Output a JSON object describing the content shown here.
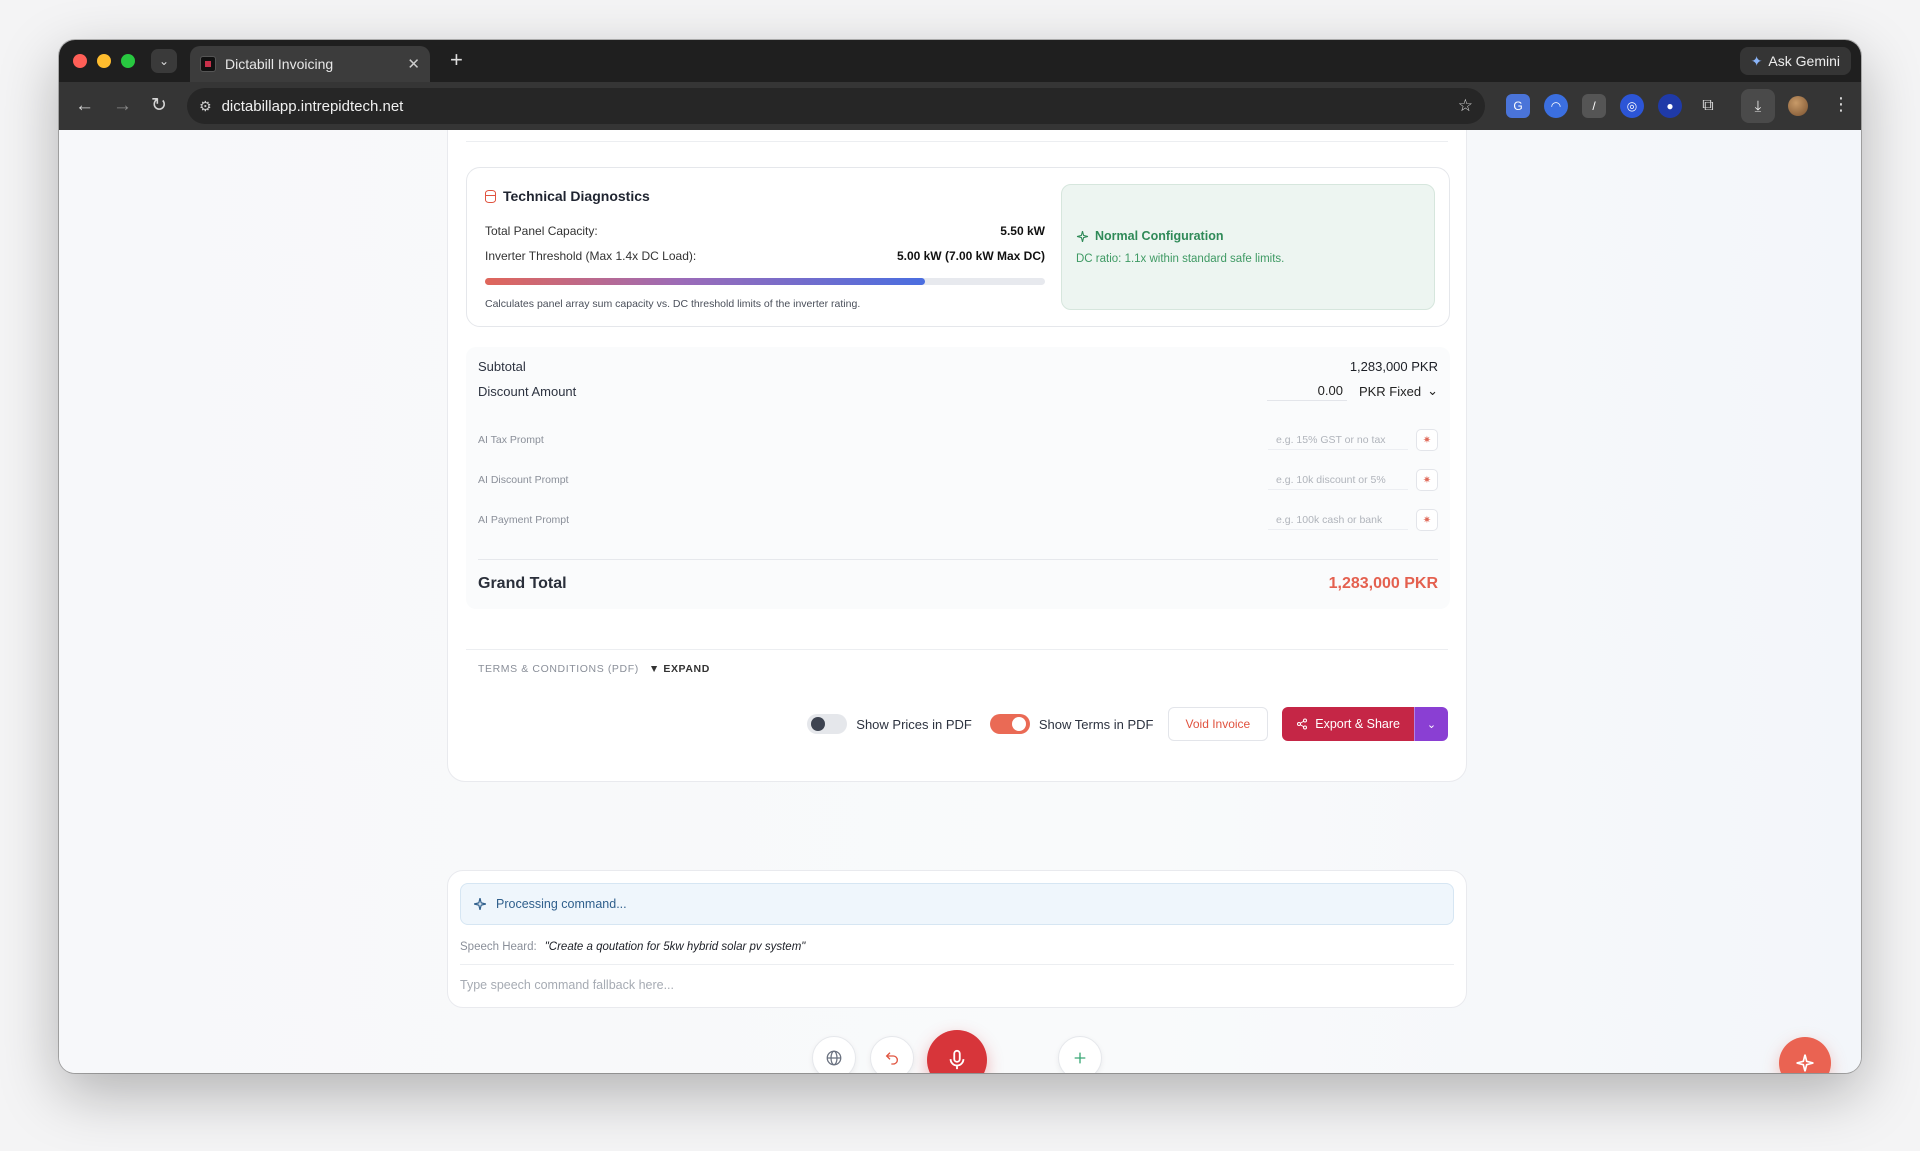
{
  "browser": {
    "tab_title": "Dictabill Invoicing",
    "tab_close": "✕",
    "new_tab": "+",
    "ask_gemini": "Ask Gemini",
    "url": "dictabillapp.intrepidtech.net"
  },
  "diagnostics": {
    "title": "Technical Diagnostics",
    "rows": [
      {
        "label": "Total Panel Capacity:",
        "value": "5.50 kW"
      },
      {
        "label": "Inverter Threshold (Max 1.4x DC Load):",
        "value": "5.00 kW (7.00 kW Max DC)"
      }
    ],
    "bar_fill_percent": 78.6,
    "note": "Calculates panel array sum capacity vs. DC threshold limits of the inverter rating.",
    "status_title": "Normal Configuration",
    "status_desc": "DC ratio: 1.1x within standard safe limits.",
    "status_color": "#2f8a58"
  },
  "totals": {
    "subtotal_label": "Subtotal",
    "subtotal_value": "1,283,000 PKR",
    "discount_label": "Discount Amount",
    "discount_value": "0.00",
    "discount_type": "PKR Fixed",
    "ai_prompts": [
      {
        "label": "AI Tax Prompt",
        "placeholder": "e.g. 15% GST or no tax"
      },
      {
        "label": "AI Discount Prompt",
        "placeholder": "e.g. 10k discount or 5%"
      },
      {
        "label": "AI Payment Prompt",
        "placeholder": "e.g. 100k cash or bank"
      }
    ],
    "grand_total_label": "Grand Total",
    "grand_total_value": "1,283,000 PKR",
    "accent_color": "#e4604f"
  },
  "terms": {
    "label": "TERMS & CONDITIONS (PDF)",
    "expand": "▼ EXPAND"
  },
  "actions": {
    "show_prices_label": "Show Prices in PDF",
    "show_prices_on": false,
    "show_terms_label": "Show Terms in PDF",
    "show_terms_on": true,
    "void_label": "Void Invoice",
    "export_label": "Export & Share"
  },
  "command": {
    "status": "Processing command...",
    "speech_label": "Speech Heard:",
    "speech_text": "\"Create a qoutation for 5kw hybrid solar pv system\"",
    "input_placeholder": "Type speech command fallback here..."
  },
  "icons": {
    "diagnostics": "database-icon",
    "status": "sparkle-icon",
    "ai_button": "sparkle-icon",
    "export": "share-icon",
    "globe": "globe-icon",
    "undo": "undo-icon",
    "mic": "microphone-icon",
    "add": "plus-icon",
    "fab": "sparkle-icon"
  }
}
